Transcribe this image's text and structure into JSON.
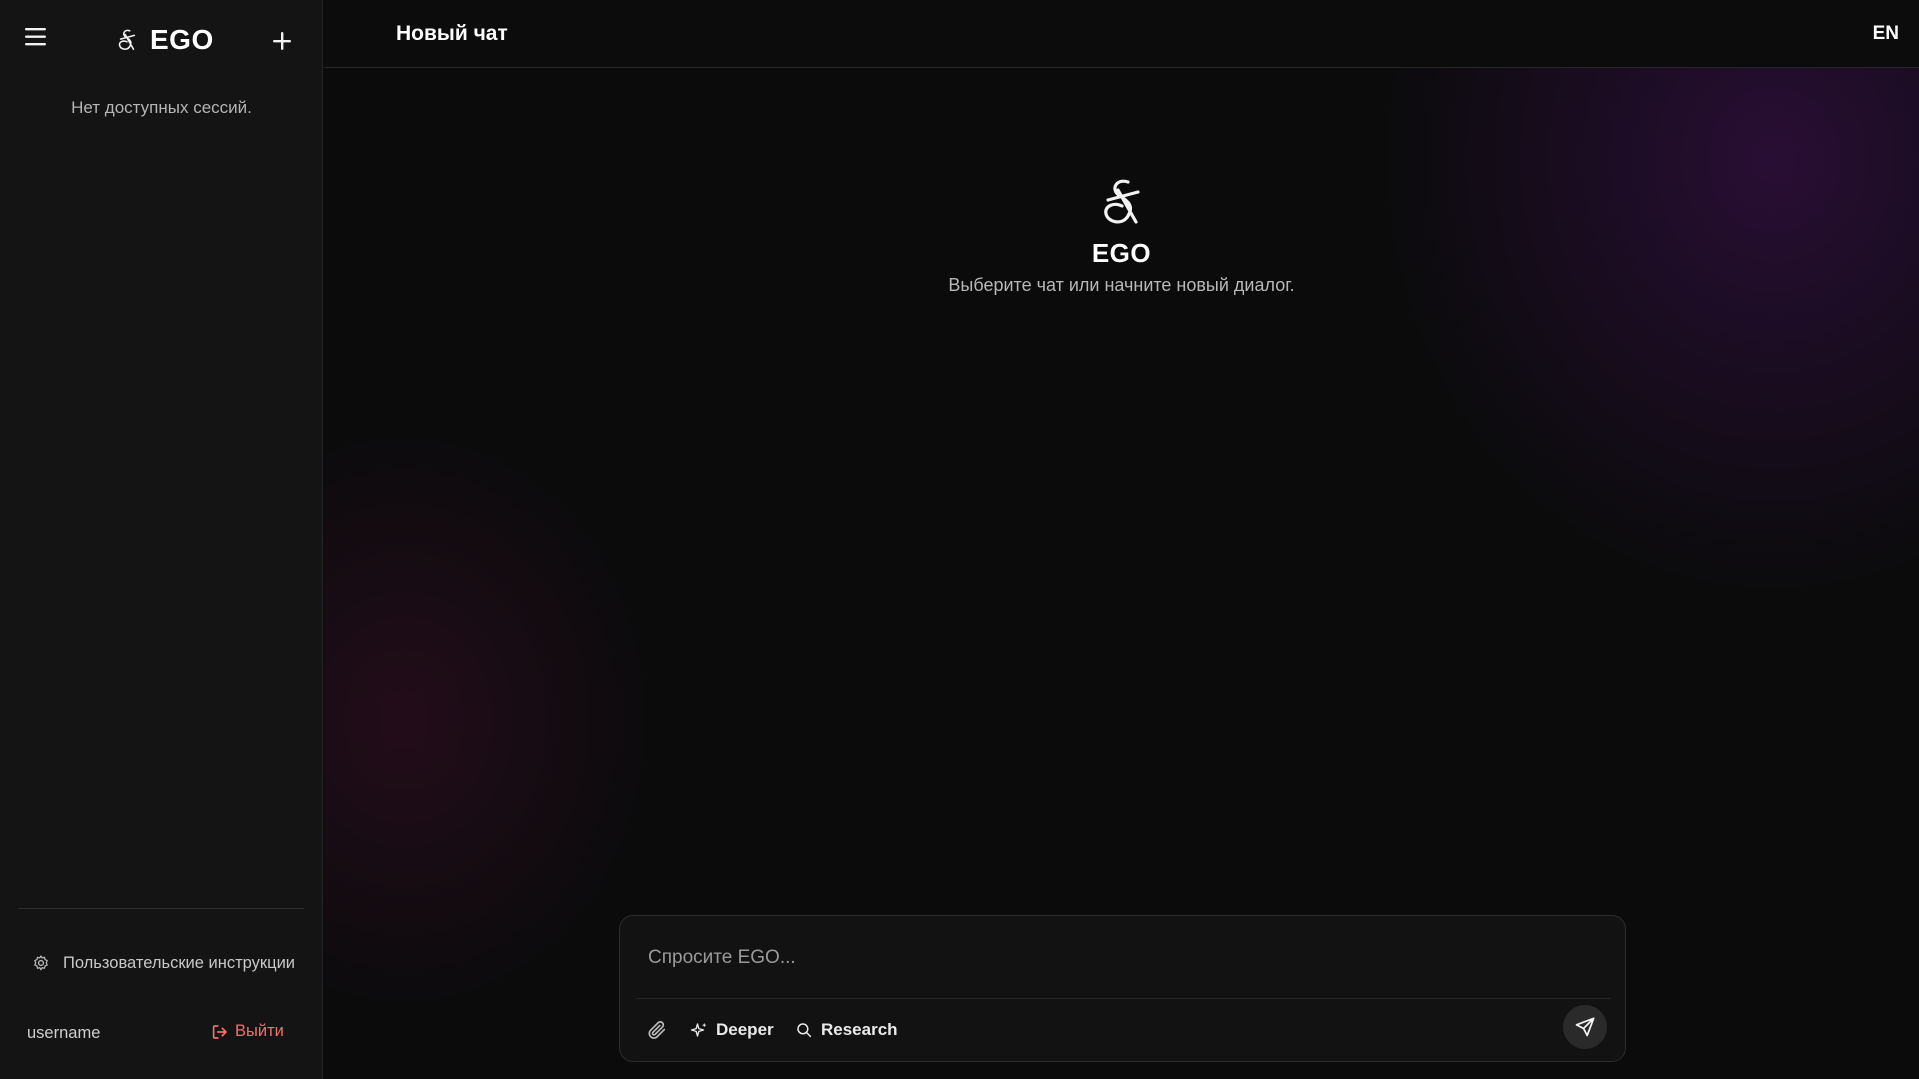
{
  "sidebar": {
    "brand": "EGO",
    "empty_sessions": "Нет доступных сессий.",
    "custom_instructions": "Пользовательские инструкции",
    "username": "username",
    "logout_label": "Выйти"
  },
  "header": {
    "title": "Новый чат",
    "language": "EN"
  },
  "hero": {
    "title": "EGO",
    "subtitle": "Выберите чат или начните новый диалог."
  },
  "composer": {
    "placeholder": "Спросите EGO...",
    "deeper_label": "Deeper",
    "research_label": "Research"
  },
  "icons": [
    "menu-icon",
    "logo-icon",
    "plus-icon",
    "gear-icon",
    "logout-icon",
    "paperclip-icon",
    "sparkle-icon",
    "search-icon",
    "send-icon"
  ],
  "colors": {
    "background": "#0b0b0c",
    "sidebar": "#141414",
    "logout": "#f2706d",
    "accent_glow": "#581276"
  }
}
